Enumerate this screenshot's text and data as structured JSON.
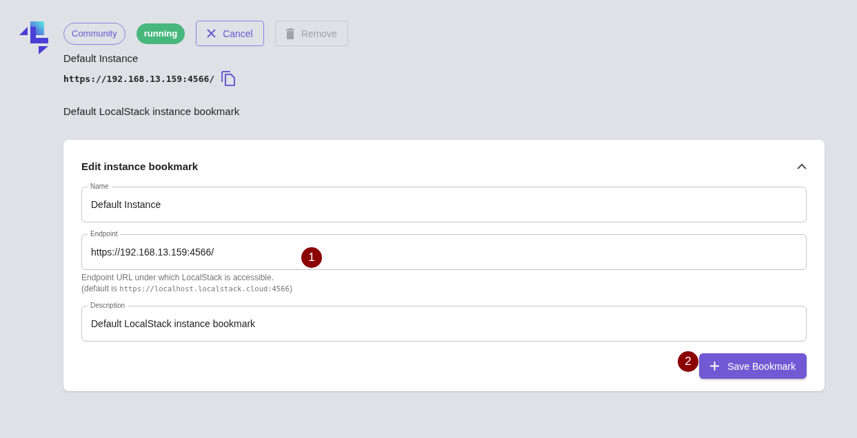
{
  "header": {
    "chips": [
      {
        "label": "Community",
        "kind": "outline"
      },
      {
        "label": "running",
        "kind": "status",
        "color": "#48b77e"
      }
    ],
    "buttons": [
      {
        "label": "Cancel",
        "kind": "close",
        "disabled": false
      },
      {
        "label": "Remove",
        "kind": "delete",
        "disabled": true
      }
    ]
  },
  "instance": {
    "name": "Default Instance",
    "endpoint": "https://192.168.13.159:4566/",
    "description": "Default LocalStack instance bookmark"
  },
  "edit_card": {
    "title": "Edit instance bookmark",
    "expanded": true,
    "fields": [
      {
        "label": "Name",
        "value": "Default Instance"
      },
      {
        "label": "Endpoint",
        "value": "https://192.168.13.159:4566/",
        "help": "Endpoint URL under which LocalStack is accessible.",
        "help_prefix": "(default is ",
        "help_code": "https://localhost.localstack.cloud:4566",
        "help_suffix": ")"
      },
      {
        "label": "Description",
        "value": "Default LocalStack instance bookmark"
      }
    ],
    "save_button": "Save Bookmark"
  },
  "annotations": [
    {
      "label": "1"
    },
    {
      "label": "2"
    }
  ]
}
